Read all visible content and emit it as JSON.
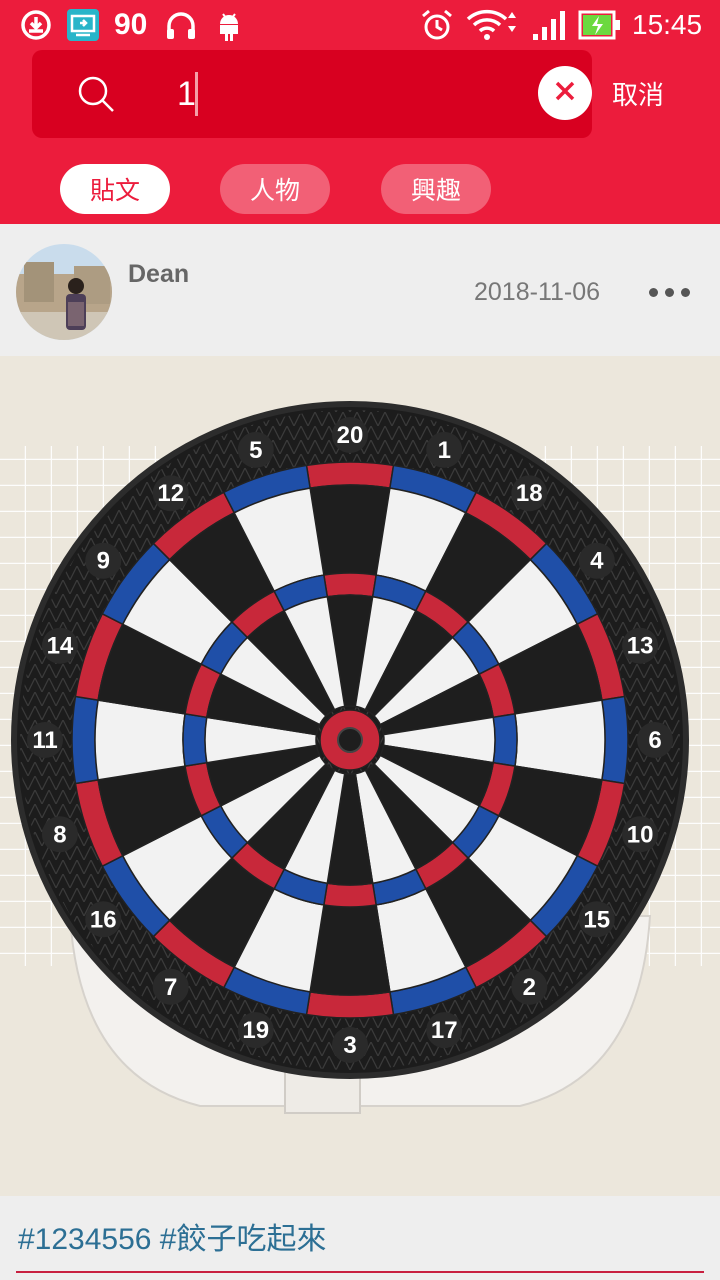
{
  "status_bar": {
    "battery_level_text": "90",
    "time": "15:45",
    "icons": [
      "download-icon",
      "screen-cast-icon",
      "headset-icon",
      "android-icon",
      "alarm-icon",
      "wifi-icon",
      "signal-icon",
      "battery-charging-icon"
    ]
  },
  "search": {
    "value": "1",
    "clear_icon": "close-icon",
    "cancel_label": "取消"
  },
  "tabs": [
    {
      "label": "貼文",
      "active": true
    },
    {
      "label": "人物",
      "active": false
    },
    {
      "label": "興趣",
      "active": false
    }
  ],
  "post": {
    "author": "Dean",
    "date": "2018-11-06",
    "image": "dartboard",
    "tags": "#1234556 #餃子吃起來"
  },
  "dartboard": {
    "numbers": [
      "20",
      "1",
      "18",
      "4",
      "13",
      "6",
      "10",
      "15",
      "2",
      "17",
      "3",
      "19",
      "7",
      "16",
      "8",
      "11",
      "14",
      "9",
      "12",
      "5"
    ]
  },
  "colors": {
    "accent": "#ec1c3c",
    "search_bg": "#d80020",
    "tag_text": "#2c6f94",
    "board_red": "#c8283a",
    "board_blue": "#1f4fa8"
  }
}
